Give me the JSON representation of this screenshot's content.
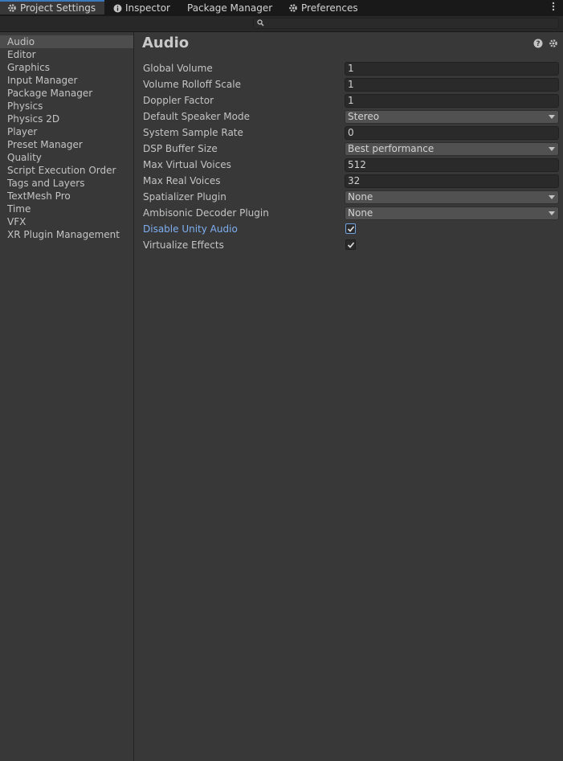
{
  "tabs": [
    {
      "label": "Project Settings",
      "icon": "gear-icon",
      "active": true
    },
    {
      "label": "Inspector",
      "icon": "info-icon",
      "active": false
    },
    {
      "label": "Package Manager",
      "icon": "",
      "active": false
    },
    {
      "label": "Preferences",
      "icon": "gear-icon",
      "active": false
    }
  ],
  "search": {
    "value": "",
    "placeholder": ""
  },
  "sidebar": {
    "items": [
      {
        "label": "Audio",
        "selected": true
      },
      {
        "label": "Editor"
      },
      {
        "label": "Graphics"
      },
      {
        "label": "Input Manager"
      },
      {
        "label": "Package Manager"
      },
      {
        "label": "Physics"
      },
      {
        "label": "Physics 2D"
      },
      {
        "label": "Player"
      },
      {
        "label": "Preset Manager"
      },
      {
        "label": "Quality"
      },
      {
        "label": "Script Execution Order"
      },
      {
        "label": "Tags and Layers"
      },
      {
        "label": "TextMesh Pro"
      },
      {
        "label": "Time"
      },
      {
        "label": "VFX"
      },
      {
        "label": "XR Plugin Management"
      }
    ]
  },
  "main": {
    "title": "Audio",
    "settings": [
      {
        "label": "Global Volume",
        "type": "text",
        "value": "1"
      },
      {
        "label": "Volume Rolloff Scale",
        "type": "text",
        "value": "1"
      },
      {
        "label": "Doppler Factor",
        "type": "text",
        "value": "1"
      },
      {
        "label": "Default Speaker Mode",
        "type": "dropdown",
        "value": "Stereo"
      },
      {
        "label": "System Sample Rate",
        "type": "text",
        "value": "0"
      },
      {
        "label": "DSP Buffer Size",
        "type": "dropdown",
        "value": "Best performance"
      },
      {
        "label": "Max Virtual Voices",
        "type": "text",
        "value": "512"
      },
      {
        "label": "Max Real Voices",
        "type": "text",
        "value": "32"
      },
      {
        "label": "Spatializer Plugin",
        "type": "dropdown",
        "value": "None"
      },
      {
        "label": "Ambisonic Decoder Plugin",
        "type": "dropdown",
        "value": "None"
      },
      {
        "label": "Disable Unity Audio",
        "type": "checkbox",
        "checked": true,
        "focused": true
      },
      {
        "label": "Virtualize Effects",
        "type": "checkbox",
        "checked": true
      }
    ]
  },
  "colors": {
    "background": "#383838",
    "tabbar": "#191919",
    "accent": "#3a79bb",
    "highlight_label": "#7eaff2",
    "selected_item": "#4d4d4d"
  }
}
